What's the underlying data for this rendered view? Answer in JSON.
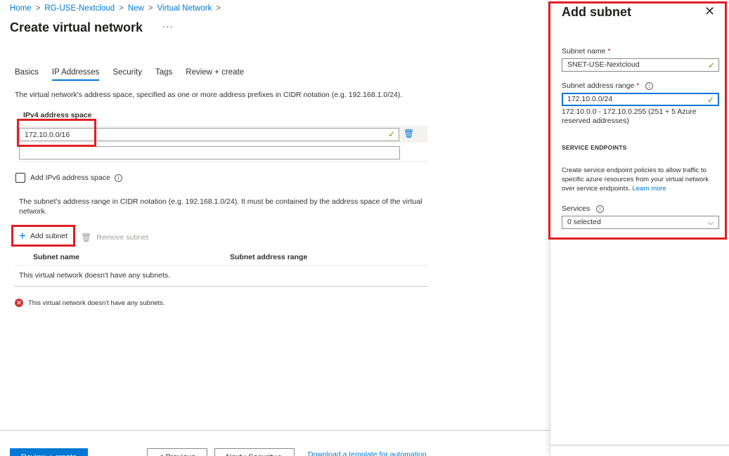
{
  "breadcrumb": [
    "Home",
    "RG-USE-Nextcloud",
    "New",
    "Virtual Network"
  ],
  "page_title": "Create virtual network",
  "more_label": "···",
  "tabs": [
    {
      "label": "Basics"
    },
    {
      "label": "IP Addresses"
    },
    {
      "label": "Security"
    },
    {
      "label": "Tags"
    },
    {
      "label": "Review + create"
    }
  ],
  "ip": {
    "description": "The virtual network's address space, specified as one or more address prefixes in CIDR notation (e.g. 192.168.1.0/24).",
    "ipv4_label": "IPv4 address space",
    "address_value": "172.10.0.0/16",
    "ipv6_label": "Add IPv6 address space",
    "subnet_description": "The subnet's address range in CIDR notation (e.g. 192.168.1.0/24). It must be contained by the address space of the virtual network.",
    "add_subnet": "Add subnet",
    "remove_subnet": "Remove subnet",
    "col_subnet_name": "Subnet name",
    "col_subnet_range": "Subnet address range",
    "empty_message": "This virtual network doesn't have any subnets.",
    "error_message": "This virtual network doesn't have any subnets."
  },
  "footer": {
    "review_create": "Review + create",
    "previous": "< Previous",
    "next": "Next : Security >",
    "download": "Download a template for automation"
  },
  "panel": {
    "title": "Add subnet",
    "subnet_name_label": "Subnet name",
    "subnet_name_value": "SNET-USE-Nextcloud",
    "range_label": "Subnet address range",
    "range_value": "172.10.0.0/24",
    "range_hint": "172.10.0.0 - 172.10.0.255 (251 + 5 Azure reserved addresses)",
    "service_endpoints_heading": "SERVICE ENDPOINTS",
    "service_desc": "Create service endpoint policies to allow traffic to specific azure resources from your virtual network over service endpoints.",
    "learn_more": "Learn more",
    "services_label": "Services",
    "services_value": "0 selected"
  },
  "colors": {
    "accent": "#0078d4",
    "valid": "#57a300",
    "error": "#d13438",
    "highlight": "#e31e24"
  }
}
